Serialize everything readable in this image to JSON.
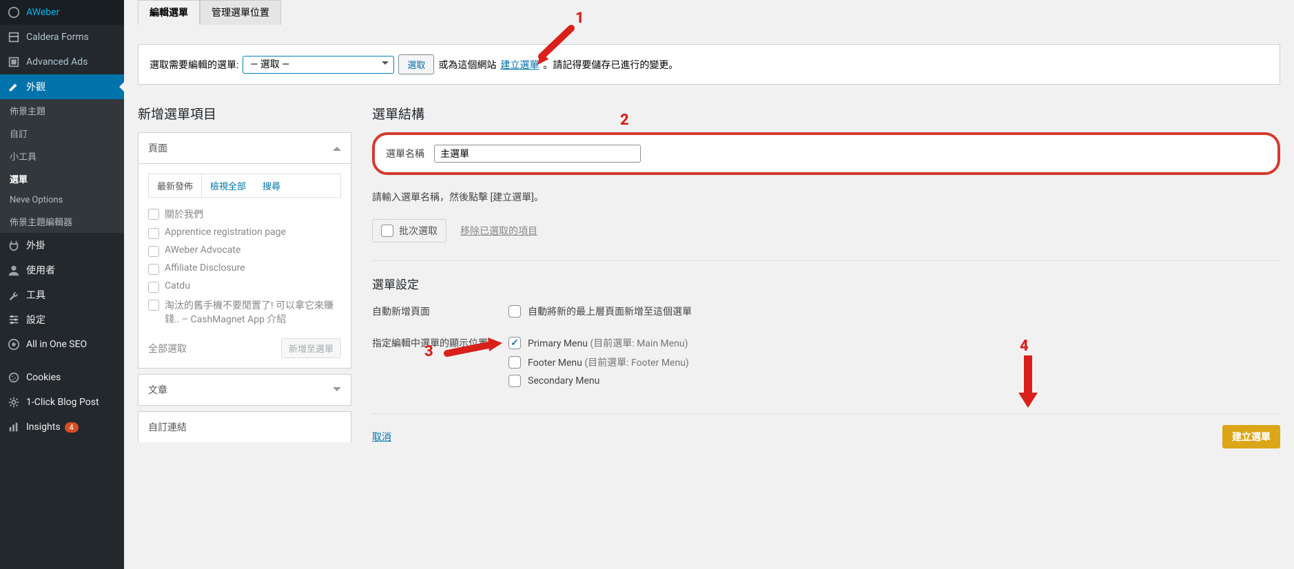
{
  "sidebar": {
    "top_items": [
      {
        "label": "AWeber"
      },
      {
        "label": "Caldera Forms"
      },
      {
        "label": "Advanced Ads"
      }
    ],
    "appearance": {
      "label": "外觀"
    },
    "sub": [
      {
        "label": "佈景主題",
        "current": false
      },
      {
        "label": "自訂",
        "current": false
      },
      {
        "label": "小工具",
        "current": false
      },
      {
        "label": "選單",
        "current": true
      },
      {
        "label": "Neve Options",
        "current": false
      },
      {
        "label": "佈景主題編輯器",
        "current": false
      }
    ],
    "bottom_items": [
      {
        "label": "外掛"
      },
      {
        "label": "使用者"
      },
      {
        "label": "工具"
      },
      {
        "label": "設定"
      },
      {
        "label": "All in One SEO"
      }
    ],
    "extra_items": [
      {
        "label": "Cookies"
      },
      {
        "label": "1-Click Blog Post"
      },
      {
        "label": "Insights",
        "badge": "4"
      }
    ]
  },
  "tabs": {
    "edit": "編輯選單",
    "manage": "管理選單位置"
  },
  "select_bar": {
    "label": "選取需要編輯的選單:",
    "placeholder": "— 選取 —",
    "select_btn": "選取",
    "or_text": "或為這個網站",
    "create_link": "建立選單",
    "tail": "。請記得要儲存已進行的變更。"
  },
  "left": {
    "heading": "新增選單項目",
    "page_head": "頁面",
    "inner_tabs": {
      "recent": "最新發佈",
      "all": "檢視全部",
      "search": "搜尋"
    },
    "pages": [
      "關於我們",
      "Apprentice registration page",
      "AWeber Advocate",
      "Affiliate Disclosure",
      "Catdu",
      "淘汰的舊手機不要閒置了! 可以拿它來賺錢.. – CashMagnet App 介紹"
    ],
    "select_all": "全部選取",
    "add_btn": "新增至選單",
    "posts_head": "文章",
    "custom_head": "自訂連結"
  },
  "right": {
    "heading": "選單結構",
    "name_label": "選單名稱",
    "name_value": "主選單",
    "helper": "請輸入選單名稱，然後點擊 [建立選單]。",
    "bulk_label": "批次選取",
    "remove_link": "移除已選取的項目",
    "settings_h": "選單設定",
    "auto_add_label": "自動新增頁面",
    "auto_add_desc": "自動將新的最上層頁面新增至這個選單",
    "loc_label": "指定編輯中選單的顯示位置",
    "loc_items": [
      {
        "name": "Primary Menu",
        "current": "(目前選單: Main Menu)",
        "checked": true
      },
      {
        "name": "Footer Menu",
        "current": "(目前選單: Footer Menu)",
        "checked": false
      },
      {
        "name": "Secondary Menu",
        "current": "",
        "checked": false
      }
    ],
    "cancel": "取消",
    "create_btn": "建立選單"
  },
  "annotations": {
    "n1": "1",
    "n2": "2",
    "n3": "3",
    "n4": "4"
  }
}
